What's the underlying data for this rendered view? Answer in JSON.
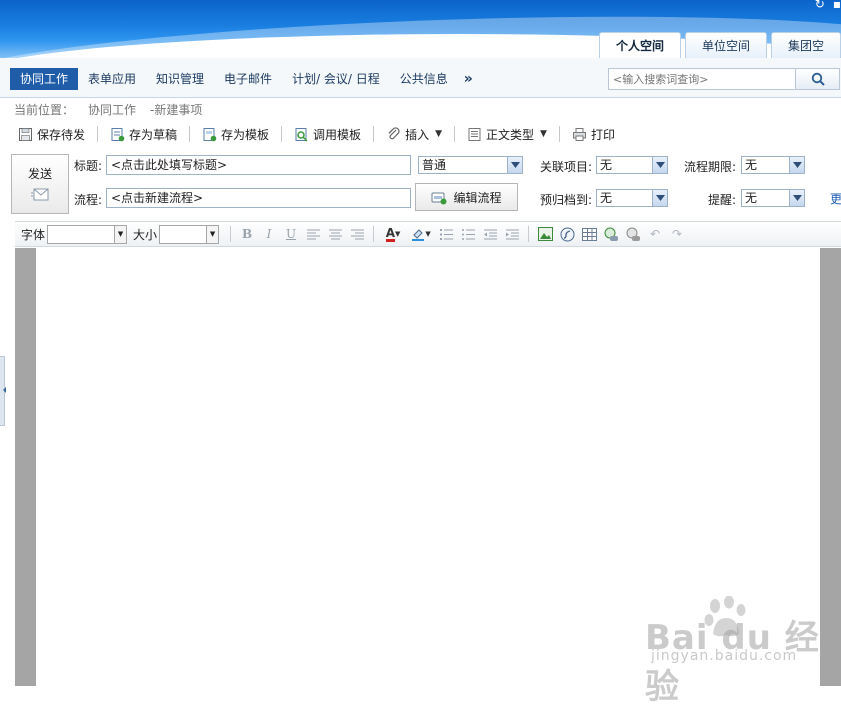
{
  "header": {
    "space_tabs": [
      {
        "label": "个人空间",
        "active": true
      },
      {
        "label": "单位空间",
        "active": false
      },
      {
        "label": "集团空",
        "active": false
      }
    ]
  },
  "menu": {
    "items": [
      {
        "label": "协同工作",
        "active": true
      },
      {
        "label": "表单应用",
        "active": false
      },
      {
        "label": "知识管理",
        "active": false
      },
      {
        "label": "电子邮件",
        "active": false
      },
      {
        "label": "计划/ 会议/ 日程",
        "active": false
      },
      {
        "label": "公共信息",
        "active": false
      }
    ],
    "more": "»",
    "search_placeholder": "<输入搜索词查询>"
  },
  "breadcrumb": {
    "prefix": "当前位置：",
    "section": "协同工作",
    "page": "-新建事项"
  },
  "toolbar": {
    "save_pending": "保存待发",
    "save_draft": "存为草稿",
    "save_template": "存为模板",
    "use_template": "调用模板",
    "insert": "插入",
    "body_type": "正文类型",
    "print": "打印"
  },
  "form": {
    "send": "发送",
    "title_label": "标题:",
    "title_value": "<点击此处填写标题>",
    "priority": "普通",
    "related_label": "关联项目:",
    "related_value": "无",
    "deadline_label": "流程期限:",
    "deadline_value": "无",
    "flow_label": "流程:",
    "flow_value": "<点击新建流程>",
    "edit_flow": "编辑流程",
    "archive_label": "预归档到:",
    "archive_value": "无",
    "remind_label": "提醒:",
    "remind_value": "无",
    "more": "更"
  },
  "editor": {
    "font_label": "字体",
    "size_label": "大小",
    "bold": "B",
    "italic": "I",
    "underline": "U",
    "font_color": "A"
  },
  "watermark": {
    "brand": "Bai  du 经验",
    "url": "jingyan.baidu.com"
  },
  "colors": {
    "menu_active": "#1f5da8",
    "banner": "#1a7fe0"
  }
}
